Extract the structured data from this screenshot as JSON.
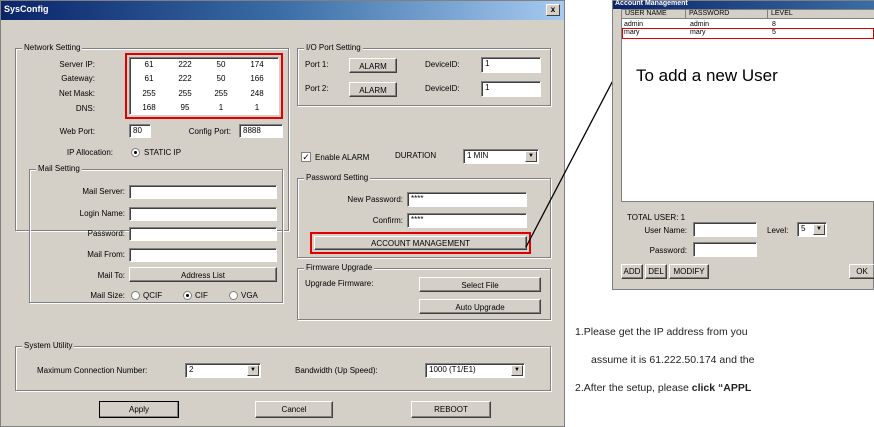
{
  "dialog": {
    "title": "SysConfig",
    "close_label": "x",
    "network": {
      "legend": "Network Setting",
      "rows": [
        {
          "label": "Server IP:",
          "values": [
            "61",
            "222",
            "50",
            "174"
          ]
        },
        {
          "label": "Gateway:",
          "values": [
            "61",
            "222",
            "50",
            "166"
          ]
        },
        {
          "label": "Net Mask:",
          "values": [
            "255",
            "255",
            "255",
            "248"
          ]
        },
        {
          "label": "DNS:",
          "values": [
            "168",
            "95",
            "1",
            "1"
          ]
        }
      ],
      "web_port_label": "Web Port:",
      "web_port_value": "80",
      "config_port_label": "Config Port:",
      "config_port_value": "8888",
      "ip_mode_label": "IP Allocation:",
      "ip_mode_value": "STATIC IP"
    },
    "mail": {
      "legend": "Mail Setting",
      "server_label": "Mail Server:",
      "login_label": "Login Name:",
      "password_label": "Password:",
      "from_label": "Mail From:",
      "to_label": "Mail To:",
      "address_list_button": "Address List",
      "size_label": "Mail Size:",
      "size_options": [
        "QCIF",
        "CIF",
        "VGA"
      ],
      "size_selected": "CIF"
    },
    "io": {
      "legend": "I/O Port Setting",
      "port1_label": "Port 1:",
      "port1_button": "ALARM",
      "port2_label": "Port 2:",
      "port2_button": "ALARM",
      "device1_label": "DeviceID:",
      "device1_value": "1",
      "device2_label": "DeviceID:",
      "device2_value": "1"
    },
    "alarm": {
      "enable_label": "Enable ALARM",
      "duration_label": "DURATION",
      "duration_value": "1 MIN"
    },
    "password": {
      "legend": "Password Setting",
      "new_label": "New Password:",
      "new_value": "****",
      "confirm_label": "Confirm:",
      "confirm_value": "****",
      "account_button": "ACCOUNT MANAGEMENT"
    },
    "firmware": {
      "legend": "Firmware Upgrade",
      "upgrade_label": "Upgrade Firmware:",
      "select_button": "Select File",
      "auto_button": "Auto Upgrade"
    },
    "system": {
      "legend": "System Utility",
      "max_conn_label": "Maximum Connection Number:",
      "max_conn_value": "2",
      "bandwidth_label": "Bandwidth (Up Speed):",
      "bandwidth_value": "1000 (T1/E1)"
    },
    "buttons": {
      "apply": "Apply",
      "cancel": "Cancel",
      "reboot": "REBOOT"
    }
  },
  "account": {
    "title": "Account Management",
    "columns": [
      "USER NAME",
      "PASSWORD",
      "LEVEL"
    ],
    "rows": [
      {
        "user": "admin",
        "password": "admin",
        "level": "8"
      },
      {
        "user": "mary",
        "password": "mary",
        "level": "5"
      }
    ],
    "annotation": "To add a new User",
    "total_label": "TOTAL USER: 1",
    "user_name_label": "User Name:",
    "level_label": "Level:",
    "level_value": "5",
    "password_label": "Password:",
    "add_button": "ADD",
    "del_button": "DEL",
    "modify_button": "MODIFY",
    "ok_button": "OK"
  },
  "footer": {
    "line1": "1.Please  get the IP address from you",
    "line2": "assume it is 61.222.50.174 and the",
    "line3_prefix": "2.After the setup, please ",
    "line3_bold": "click “APPL"
  },
  "colors": {
    "highlight": "#e00000",
    "title_bar": "#0a246a",
    "dialog_bg": "#d4d0c8"
  }
}
